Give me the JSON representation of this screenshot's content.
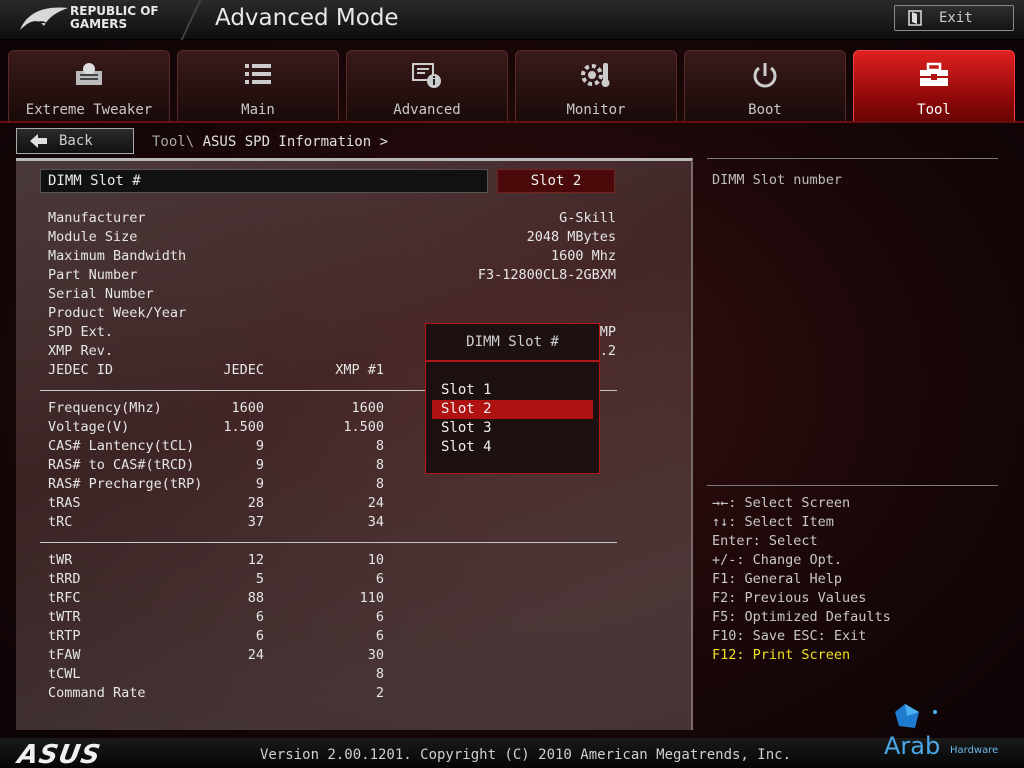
{
  "header": {
    "brand_line1": "REPUBLIC OF",
    "brand_line2": "GAMERS",
    "title": "Advanced Mode",
    "exit_label": "Exit"
  },
  "tabs": [
    {
      "label": "Extreme Tweaker",
      "icon": "tweaker-icon"
    },
    {
      "label": "Main",
      "icon": "list-icon"
    },
    {
      "label": "Advanced",
      "icon": "advanced-info-icon"
    },
    {
      "label": "Monitor",
      "icon": "thermometer-gear-icon"
    },
    {
      "label": "Boot",
      "icon": "power-icon"
    },
    {
      "label": "Tool",
      "icon": "toolbox-icon",
      "active": true
    }
  ],
  "nav": {
    "back_label": "Back",
    "breadcrumb_parent": "Tool\\ ",
    "breadcrumb_current": "ASUS SPD Information >"
  },
  "spd": {
    "dimm_slot_label": "DIMM Slot #",
    "dimm_slot_value": "Slot 2",
    "info": [
      {
        "label": "Manufacturer",
        "value": "G-Skill"
      },
      {
        "label": "Module Size",
        "value": "2048 MBytes"
      },
      {
        "label": "Maximum Bandwidth",
        "value": "1600 Mhz"
      },
      {
        "label": "Part Number",
        "value": "F3-12800CL8-2GBXM"
      },
      {
        "label": "Serial Number",
        "value": ""
      },
      {
        "label": "Product Week/Year",
        "value": ""
      },
      {
        "label": "SPD Ext.",
        "value": "MP"
      },
      {
        "label": "XMP Rev.",
        "value": ".2"
      }
    ],
    "timing_header": {
      "label": "JEDEC ID",
      "col1": "JEDEC",
      "col2": "XMP #1"
    },
    "timings_a": [
      {
        "label": "Frequency(Mhz)",
        "jedec": "1600",
        "xmp": "1600"
      },
      {
        "label": "Voltage(V)",
        "jedec": "1.500",
        "xmp": "1.500"
      },
      {
        "label": "CAS# Lantency(tCL)",
        "jedec": "9",
        "xmp": "8"
      },
      {
        "label": "RAS# to CAS#(tRCD)",
        "jedec": "9",
        "xmp": "8"
      },
      {
        "label": "RAS# Precharge(tRP)",
        "jedec": "9",
        "xmp": "8"
      },
      {
        "label": "tRAS",
        "jedec": "28",
        "xmp": "24"
      },
      {
        "label": "tRC",
        "jedec": "37",
        "xmp": "34"
      }
    ],
    "timings_b": [
      {
        "label": "tWR",
        "jedec": "12",
        "xmp": "10"
      },
      {
        "label": "tRRD",
        "jedec": "5",
        "xmp": "6"
      },
      {
        "label": "tRFC",
        "jedec": "88",
        "xmp": "110"
      },
      {
        "label": "tWTR",
        "jedec": "6",
        "xmp": "6"
      },
      {
        "label": "tRTP",
        "jedec": "6",
        "xmp": "6"
      },
      {
        "label": "tFAW",
        "jedec": "24",
        "xmp": "30"
      },
      {
        "label": "tCWL",
        "jedec": "",
        "xmp": "8"
      },
      {
        "label": "Command Rate",
        "jedec": "",
        "xmp": "2"
      }
    ]
  },
  "popup": {
    "title": "DIMM Slot #",
    "options": [
      "Slot 1",
      "Slot 2",
      "Slot 3",
      "Slot 4"
    ],
    "selected": "Slot 2"
  },
  "help": {
    "description": "DIMM Slot number",
    "keys": [
      "→←: Select Screen",
      "↑↓: Select Item",
      "Enter: Select",
      "+/-: Change Opt.",
      "F1: General Help",
      "F2: Previous Values",
      "F5: Optimized Defaults",
      "F10: Save  ESC: Exit",
      "F12: Print Screen"
    ],
    "highlight_color": "#f0e020"
  },
  "footer": {
    "brand": "ASUS",
    "version": "Version 2.00.1201. Copyright (C) 2010 American Megatrends, Inc.",
    "watermark": "Arab",
    "watermark_sub": "Hardware"
  },
  "colors": {
    "accent_red": "#b01212",
    "active_tab": "#e02020"
  }
}
